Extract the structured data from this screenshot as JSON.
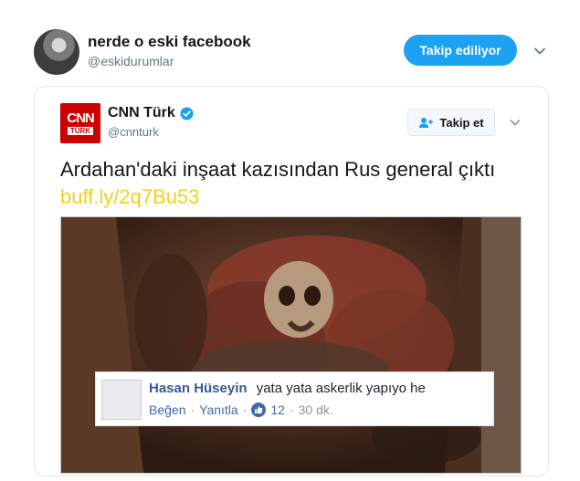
{
  "outer_tweet": {
    "display_name": "nerde o eski facebook",
    "handle": "@eskidurumlar",
    "follow_label": "Takip ediliyor"
  },
  "quoted_tweet": {
    "display_name": "CNN Türk",
    "handle": "@cnnturk",
    "logo_line1": "CNN",
    "logo_line2": "TÜRK",
    "follow_label": "Takip et",
    "text": "Ardahan'daki inşaat kazısından Rus general çıktı",
    "link": "buff.ly/2q7Bu53"
  },
  "facebook_comment": {
    "name": "Hasan Hüseyin",
    "comment": "yata yata askerlik yapıyo he",
    "like_action": "Beğen",
    "separator": "·",
    "reply_action": "Yanıtla",
    "like_count": "12",
    "time_ago": "30 dk."
  },
  "colors": {
    "twitter_blue": "#1da1f2",
    "cnn_red": "#cc0000",
    "link_yellow": "#f3d019",
    "facebook_blue": "#4267b2"
  },
  "icons": [
    "chevron-down-icon",
    "verified-badge-icon",
    "add-user-icon",
    "facebook-like-icon"
  ]
}
